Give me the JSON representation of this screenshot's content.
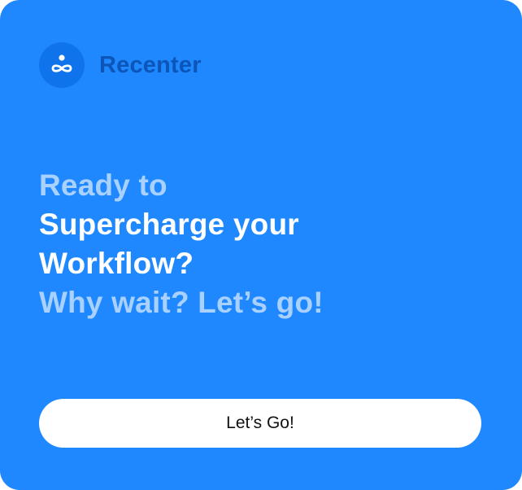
{
  "brand": {
    "name": "Recenter",
    "icon": "recenter-logo-icon"
  },
  "headline": {
    "line1": "Ready to",
    "line2": "Supercharge your",
    "line3": "Workflow?",
    "line4": "Why wait? Let’s go!"
  },
  "cta": {
    "label": "Let’s Go!"
  },
  "colors": {
    "card_background": "#1f88fe",
    "logo_circle": "#0f74ec",
    "brand_text": "#0b56b8",
    "muted_text": "#a9d1ff",
    "strong_text": "#ffffff",
    "button_background": "#ffffff"
  }
}
